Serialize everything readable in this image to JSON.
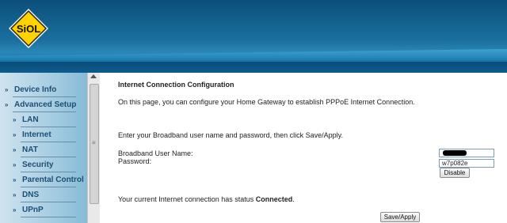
{
  "brand": {
    "logo_text": "SiOL",
    "logo_color": "#ffd200"
  },
  "sidebar": {
    "items": [
      {
        "label": "Device Info",
        "level": 0
      },
      {
        "label": "Advanced Setup",
        "level": 0
      },
      {
        "label": "LAN",
        "level": 1
      },
      {
        "label": "Internet",
        "level": 1
      },
      {
        "label": "NAT",
        "level": 1
      },
      {
        "label": "Security",
        "level": 1
      },
      {
        "label": "Parental Control",
        "level": 1
      },
      {
        "label": "DNS",
        "level": 1
      },
      {
        "label": "UPnP",
        "level": 1
      }
    ]
  },
  "main": {
    "title": "Internet Connection Configuration",
    "intro": "On this page, you can configure your Home Gateway to establish PPPoE Internet Connection.",
    "instructions": "Enter your Broadband user name and password, then click Save/Apply.",
    "username_label": "Broadband User Name:",
    "password_label": "Password:",
    "username_value": "",
    "password_value": "w7p082e",
    "disable_label": "Disable",
    "status_prefix": "Your current Internet connection has status ",
    "status_value": "Connected",
    "status_suffix": ".",
    "save_label": "Save/Apply"
  }
}
